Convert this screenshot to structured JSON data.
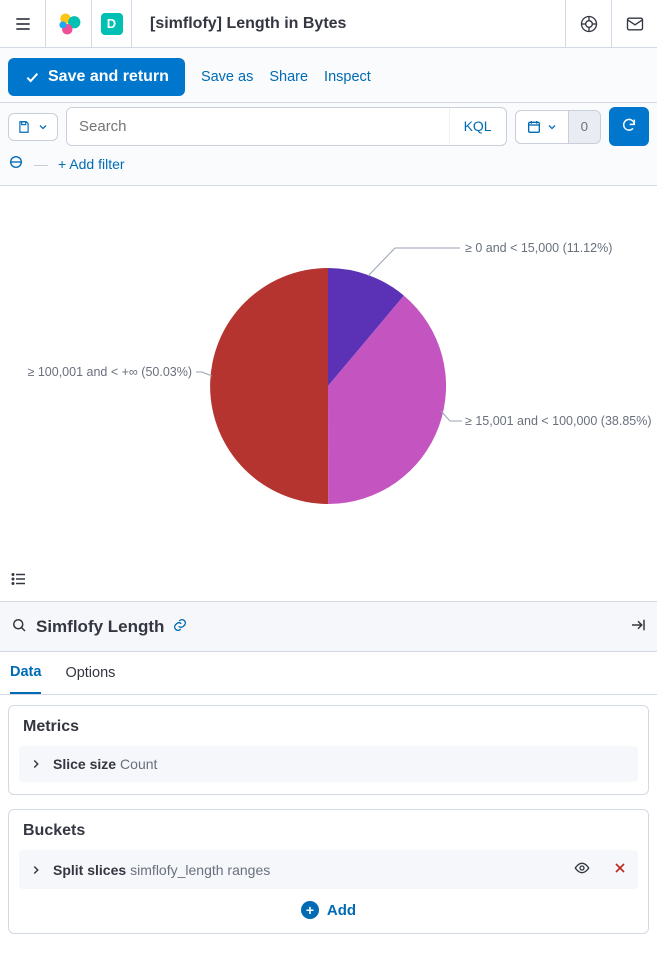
{
  "header": {
    "title": "[simflofy] Length in Bytes",
    "badge_letter": "D"
  },
  "actions": {
    "save_return": "Save and return",
    "save_as": "Save as",
    "share": "Share",
    "inspect": "Inspect"
  },
  "query": {
    "search_placeholder": "Search",
    "lang": "KQL",
    "time_zero": "0",
    "add_filter": "+ Add filter"
  },
  "chart_data": {
    "type": "pie",
    "title": "",
    "slices": [
      {
        "label": "≥ 100,001 and < +∞",
        "percent": 50.03,
        "color": "#b5342f"
      },
      {
        "label": "≥ 0 and < 15,000",
        "percent": 11.12,
        "color": "#5b31b5"
      },
      {
        "label": "≥ 15,001 and < 100,000",
        "percent": 38.85,
        "color": "#c354c0"
      }
    ]
  },
  "chart_labels": {
    "s0": "≥ 100,001 and < +∞ (50.03%)",
    "s1": "≥ 0 and < 15,000 (11.12%)",
    "s2": "≥ 15,001 and < 100,000 (38.85%)"
  },
  "editor": {
    "index_name": "Simflofy Length",
    "tabs": {
      "data": "Data",
      "options": "Options"
    }
  },
  "metrics": {
    "heading": "Metrics",
    "row_label": "Slice size",
    "row_sub": "Count"
  },
  "buckets": {
    "heading": "Buckets",
    "row_label": "Split slices",
    "row_sub": "simflofy_length ranges",
    "add": "Add"
  }
}
